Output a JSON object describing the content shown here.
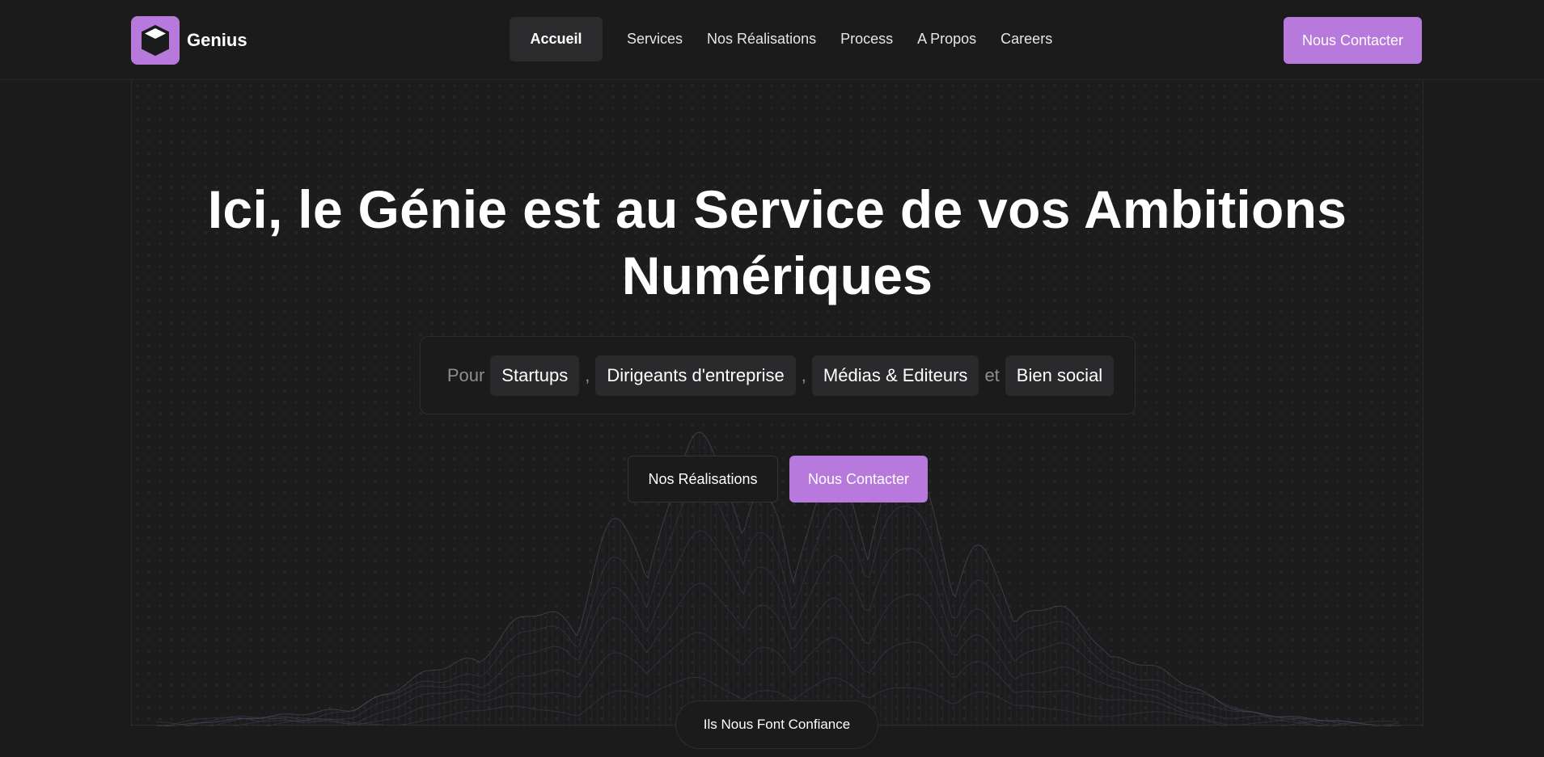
{
  "brand": {
    "name": "Genius",
    "logo_icon": "cube-icon",
    "accent": "#b879dd"
  },
  "nav": {
    "items": [
      {
        "label": "Accueil",
        "active": true
      },
      {
        "label": "Services"
      },
      {
        "label": "Nos Réalisations"
      },
      {
        "label": "Process"
      },
      {
        "label": "A Propos"
      },
      {
        "label": "Careers"
      }
    ]
  },
  "header": {
    "cta_label": "Nous Contacter"
  },
  "hero": {
    "title": "Ici, le Génie est au Service de vos Ambitions Numériques",
    "audience": {
      "prefix": "Pour",
      "chips": [
        "Startups",
        "Dirigeants d'entreprise",
        "Médias & Editeurs",
        "Bien social"
      ],
      "separators": [
        ",",
        ",",
        "et"
      ]
    },
    "secondary_label": "Nos Réalisations",
    "primary_label": "Nous Contacter"
  },
  "trust": {
    "label": "Ils Nous Font Confiance"
  },
  "colors": {
    "background": "#1b1b1c",
    "accent": "#b879dd",
    "chip": "#2a2a2c"
  }
}
